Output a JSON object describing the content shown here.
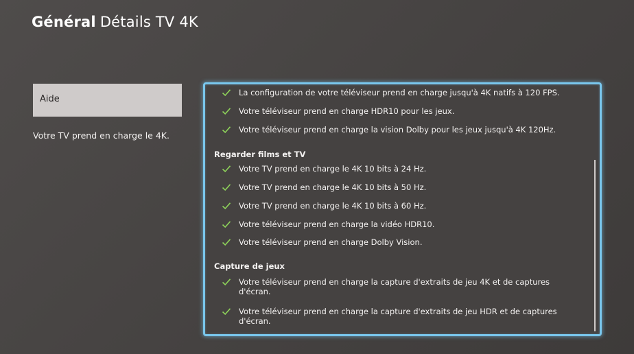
{
  "header": {
    "section": "Général",
    "title": "Détails TV 4K"
  },
  "sidebar": {
    "help_label": "Aide",
    "summary": "Votre TV prend en charge le 4K."
  },
  "panel": {
    "top_items": [
      "La configuration de votre téléviseur prend en charge jusqu'à 4K natifs à 120 FPS.",
      "Votre téléviseur prend en charge HDR10 pour les jeux.",
      "Votre téléviseur prend en charge la vision Dolby pour les jeux jusqu'à 4K 120Hz."
    ],
    "movies_title": "Regarder films et TV",
    "movies_items": [
      "Votre TV prend en charge le 4K 10 bits à 24 Hz.",
      "Votre TV prend en charge le 4K 10 bits à 50 Hz.",
      "Votre TV prend en charge le 4K 10 bits à 60 Hz.",
      "Votre téléviseur prend en charge la vidéo HDR10.",
      "Votre téléviseur prend en charge Dolby Vision."
    ],
    "capture_title": "Capture de jeux",
    "capture_items": [
      "Votre téléviseur prend en charge la capture d'extraits de jeu 4K et de captures d'écran.",
      "Votre téléviseur prend en charge la capture d'extraits de jeu HDR et de captures d'écran."
    ]
  },
  "colors": {
    "check": "#8ed35a",
    "focus_border": "#79c6ec"
  },
  "icons": {
    "check": "check-icon"
  }
}
